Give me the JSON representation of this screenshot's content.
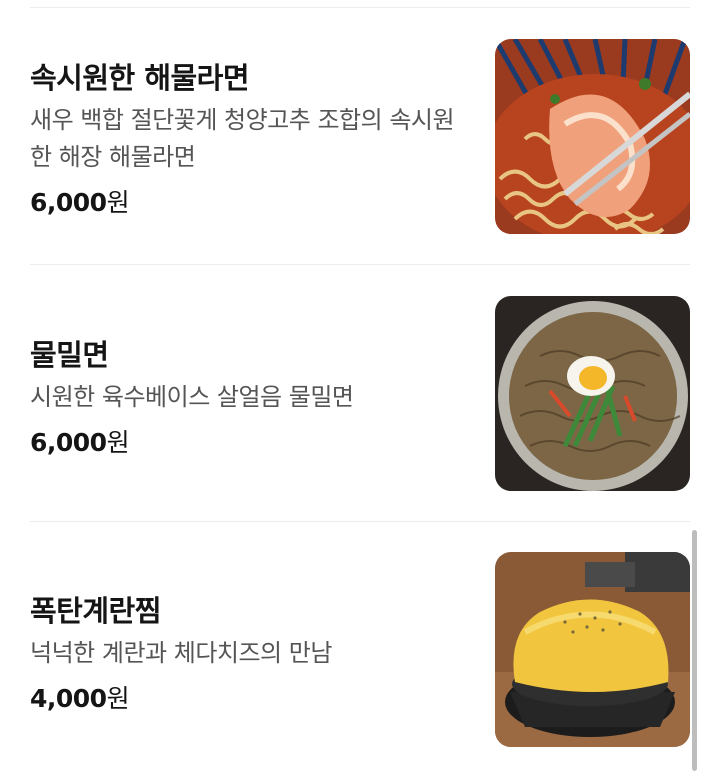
{
  "menu": {
    "items": [
      {
        "name": "속시원한 해물라면",
        "description": "새우 백합 절단꽃게 청양고추 조합의 속시원한 해장 해물라면",
        "price": "6,000",
        "currency": "원",
        "image_icon": "seafood-ramen-photo"
      },
      {
        "name": "물밀면",
        "description": "시원한 육수베이스 살얼음 물밀면",
        "price": "6,000",
        "currency": "원",
        "image_icon": "cold-noodle-photo"
      },
      {
        "name": "폭탄계란찜",
        "description": "넉넉한 계란과 체다치즈의 만남",
        "price": "4,000",
        "currency": "원",
        "image_icon": "steamed-egg-photo"
      }
    ]
  }
}
